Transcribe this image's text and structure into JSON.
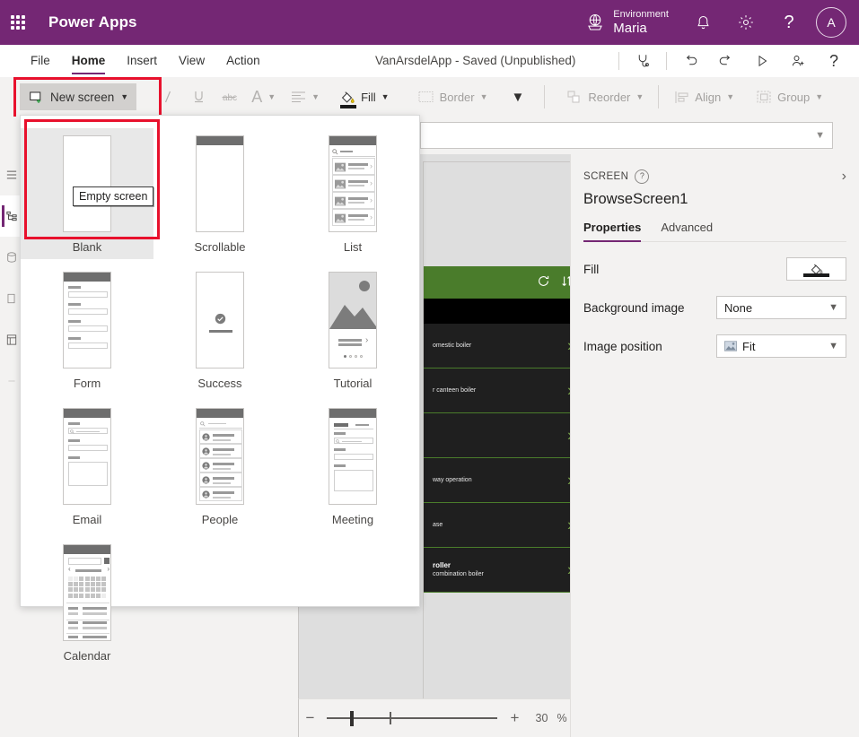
{
  "topbar": {
    "waffle_icon": "waffle-grid-icon",
    "brand": "Power Apps",
    "environment_label": "Environment",
    "environment_name": "Maria",
    "globe_icon": "environment-globe-icon",
    "notifications_icon": "bell-icon",
    "settings_icon": "gear-icon",
    "help_icon": "question-mark-icon",
    "avatar_initial": "A",
    "bg_color": "#742774"
  },
  "menubar": {
    "items": [
      {
        "label": "File",
        "active": false
      },
      {
        "label": "Home",
        "active": true
      },
      {
        "label": "Insert",
        "active": false
      },
      {
        "label": "View",
        "active": false
      },
      {
        "label": "Action",
        "active": false
      }
    ],
    "app_status": "VanArsdelApp - Saved (Unpublished)",
    "right_icons": [
      "checker-icon",
      "undo-icon",
      "redo-icon",
      "play-preview-icon",
      "share-user-icon",
      "help-question-icon"
    ]
  },
  "ribbon": {
    "new_screen_label": "New screen",
    "new_screen_icon": "new-screen-add-icon",
    "italic_icon": "italic-icon",
    "underline_icon": "underline-icon",
    "strikethrough_icon": "strikethrough-icon",
    "font_color_label": "A",
    "align_icon": "align-icon",
    "fill_label": "Fill",
    "fill_icon": "fill-bucket-icon",
    "border_label": "Border",
    "border_icon": "border-icon",
    "more_icon": "chevron-down-icon",
    "reorder_label": "Reorder",
    "reorder_icon": "reorder-icon",
    "align_label": "Align",
    "align_group_icon": "align-objects-icon",
    "group_label": "Group",
    "group_icon": "group-icon"
  },
  "formula_bar": {
    "value": "",
    "chevron_icon": "chevron-down-icon"
  },
  "left_rail": {
    "items": [
      {
        "icon": "hamburger-menu-icon",
        "selected": false
      },
      {
        "icon": "tree-view-icon",
        "selected": true
      },
      {
        "icon": "data-icon",
        "selected": false
      },
      {
        "icon": "media-icon",
        "selected": false
      },
      {
        "icon": "components-icon",
        "selected": false
      },
      {
        "icon": "advanced-tools-icon",
        "selected": false
      }
    ]
  },
  "flyout": {
    "tooltip": "Empty screen",
    "tiles": [
      {
        "label": "Blank",
        "type": "blank",
        "selected": true
      },
      {
        "label": "Scrollable",
        "type": "scrollable",
        "selected": false
      },
      {
        "label": "List",
        "type": "list",
        "selected": false
      },
      {
        "label": "Form",
        "type": "form",
        "selected": false
      },
      {
        "label": "Success",
        "type": "success",
        "selected": false
      },
      {
        "label": "Tutorial",
        "type": "tutorial",
        "selected": false
      },
      {
        "label": "Email",
        "type": "email",
        "selected": false
      },
      {
        "label": "People",
        "type": "people",
        "selected": false
      },
      {
        "label": "Meeting",
        "type": "meeting",
        "selected": false
      },
      {
        "label": "Calendar",
        "type": "calendar",
        "selected": false
      }
    ]
  },
  "canvas": {
    "phone": {
      "header_color": "#4a7c2b",
      "refresh_icon": "refresh-icon",
      "sort_icon": "sort-icon",
      "rows": [
        {
          "title": "",
          "subtitle": "omestic boiler"
        },
        {
          "title": "",
          "subtitle": "r canteen boiler"
        },
        {
          "title": "",
          "subtitle": ""
        },
        {
          "title": "",
          "subtitle": "way operation"
        },
        {
          "title": "",
          "subtitle": "ase"
        },
        {
          "title": "roller",
          "subtitle": "combination boiler"
        }
      ]
    }
  },
  "statusbar": {
    "zoom_out_icon": "minus-icon",
    "zoom_in_icon": "plus-icon",
    "zoom_value": "30",
    "zoom_unit": "%"
  },
  "right_pane": {
    "kind": "SCREEN",
    "help_icon": "question-circle-icon",
    "collapse_icon": "chevron-right-icon",
    "title": "BrowseScreen1",
    "tabs": [
      {
        "label": "Properties",
        "active": true
      },
      {
        "label": "Advanced",
        "active": false
      }
    ],
    "fill_label": "Fill",
    "fill_icon": "fill-bucket-icon",
    "background_image_label": "Background image",
    "background_image_value": "None",
    "image_position_label": "Image position",
    "image_position_value": "Fit",
    "image_position_icon": "image-icon"
  }
}
